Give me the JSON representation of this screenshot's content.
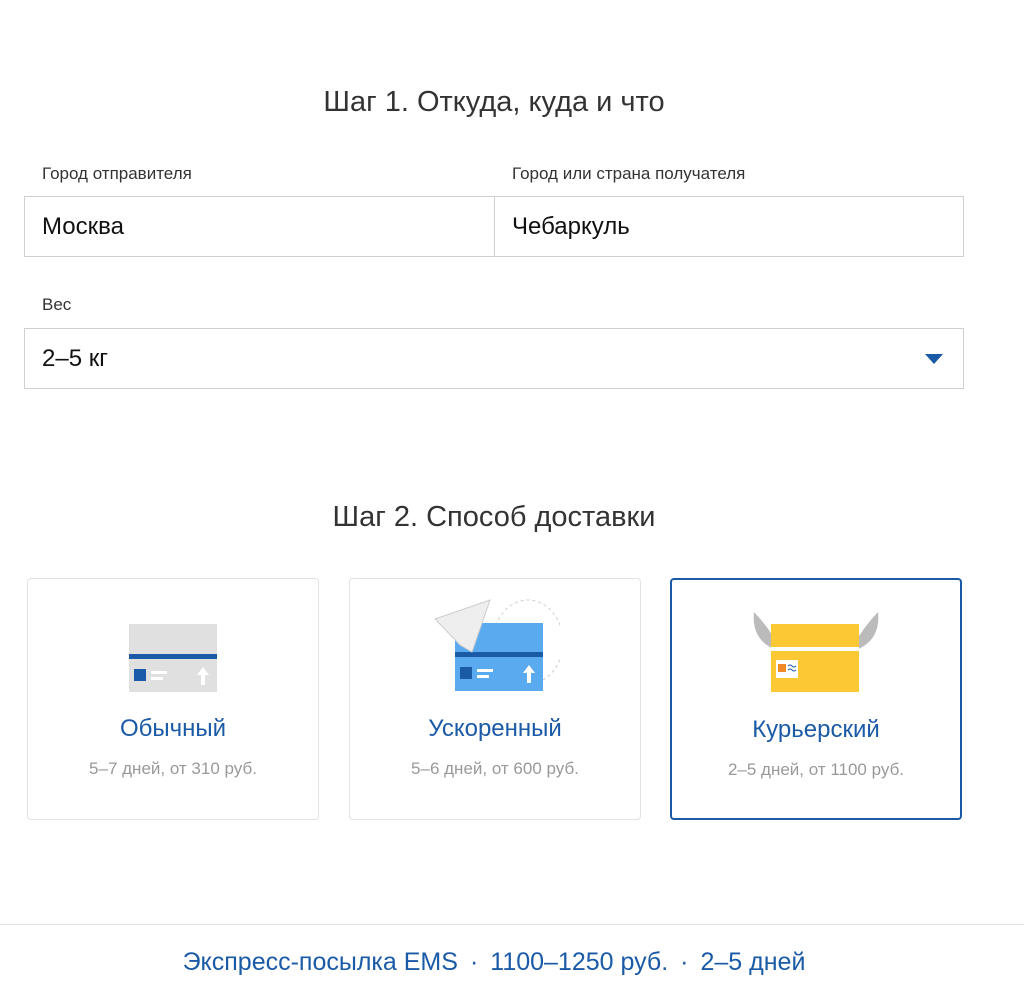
{
  "step1": {
    "title": "Шаг 1. Откуда, куда и что",
    "from_label": "Город отправителя",
    "from_value": "Москва",
    "to_label": "Город или страна получателя",
    "to_value": "Чебаркуль",
    "weight_label": "Вес",
    "weight_value": "2–5 кг"
  },
  "step2": {
    "title": "Шаг 2. Способ доставки",
    "options": [
      {
        "title": "Обычный",
        "subtitle": "5–7 дней, от 310 руб.",
        "selected": false
      },
      {
        "title": "Ускоренный",
        "subtitle": "5–6 дней, от 600 руб.",
        "selected": false
      },
      {
        "title": "Курьерский",
        "subtitle": "2–5 дней, от 1100 руб.",
        "selected": true
      }
    ]
  },
  "footer": {
    "service": "Экспресс-посылка EMS",
    "sep": "·",
    "price": "1100–1250 руб.",
    "days": "2–5 дней"
  },
  "colors": {
    "accent": "#1a5aa6",
    "yellow": "#fcc934",
    "blue": "#5aaaf0"
  }
}
